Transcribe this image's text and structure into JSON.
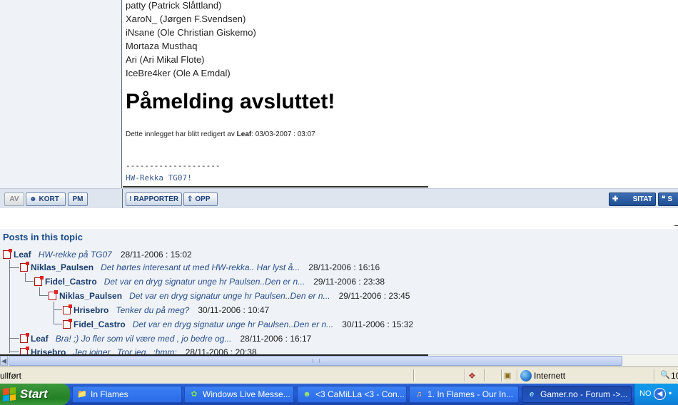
{
  "post": {
    "members": [
      "patty (Patrick Slåttland)",
      "XaroN_ (Jørgen F.Svendsen)",
      "iNsane (Ole Christian Giskemo)",
      "Mortaza Musthaq",
      "Ari (Ari Mikal Flote)",
      "IceBre4ker (Ole A Emdal)"
    ],
    "heading": "Påmelding avsluttet!",
    "edited_prefix": "Dette innlegget har blitt redigert av ",
    "edited_by": "Leaf",
    "edited_suffix": ": 03/03-2007 : 03:07",
    "signature_separator": "--------------------",
    "signature_text": "HW-Rekka TG07!"
  },
  "post_footer": {
    "av_label": "AV",
    "kort_label": "KORT",
    "pm_label": "PM",
    "rapporter_label": "RAPPORTER",
    "opp_label": "OPP",
    "sitat_label": "SITAT",
    "s2_label": "S"
  },
  "topic": {
    "title": "Posts in this topic",
    "posts": [
      {
        "author": "Leaf",
        "subject": "HW-rekke på TG07",
        "date": "28/11-2006 : 15:02"
      },
      {
        "author": "Niklas_Paulsen",
        "subject": "Det hørtes interesant ut med HW-rekka.. Har lyst å...",
        "date": "28/11-2006 : 16:16"
      },
      {
        "author": "Fidel_Castro",
        "subject": "Det var en dryg signatur unge hr Paulsen..Den er n...",
        "date": "29/11-2006 : 23:38"
      },
      {
        "author": "Niklas_Paulsen",
        "subject": "Det var en dryg signatur unge hr Paulsen..Den er n...",
        "date": "29/11-2006 : 23:45"
      },
      {
        "author": "Hrisebro",
        "subject": "Tenker du på meg?",
        "date": "30/11-2006 : 10:47"
      },
      {
        "author": "Fidel_Castro",
        "subject": "Det var en dryg signatur unge hr Paulsen..Den er n...",
        "date": "30/11-2006 : 15:32"
      },
      {
        "author": "Leaf",
        "subject": "Bra! ;) Jo fler som vil være med , jo bedre og...",
        "date": "28/11-2006 : 16:17"
      },
      {
        "author": "Hrisebro",
        "subject": "Jeg joiner.. Tror jeg.. :hmm:",
        "date": "28/11-2006 : 20:38"
      }
    ]
  },
  "statusbar": {
    "text": "ullført",
    "zone": "Internett",
    "zoom": "10"
  },
  "taskbar": {
    "start_label": "Start",
    "tasks": [
      {
        "label": "In Flames",
        "icon": "folder-icon"
      },
      {
        "label": "Windows Live Messe...",
        "icon": "messenger-icon"
      },
      {
        "label": "<3 CaMiLLa <3 - Con...",
        "icon": "messenger-chat-icon"
      },
      {
        "label": "1. In Flames - Our In...",
        "icon": "media-player-icon"
      },
      {
        "label": "Gamer.no - Forum ->...",
        "icon": "ie-icon"
      }
    ],
    "tray_lang": "NO"
  },
  "colors": {
    "accent": "#1a4a8a",
    "taskbar_blue": "#245edb",
    "start_green": "#2f8a2f"
  }
}
